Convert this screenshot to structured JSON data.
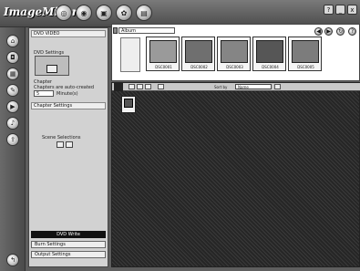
{
  "app": {
    "logo": "ImageMixer"
  },
  "toolbar": {
    "icons": [
      "disc-icon",
      "globe-icon",
      "print-icon",
      "gear-icon",
      "film-icon"
    ]
  },
  "window_controls": {
    "help": "?",
    "minimize": "_",
    "close": "x"
  },
  "left_panel": {
    "section1_title": "DVD VIDEO",
    "button_label": "DVD Settings",
    "option_label": "Chapter",
    "field_label": "Chapters are auto-created",
    "field_value": "5",
    "field_unit": "Minute(s)",
    "section2_title": "Chapter Settings",
    "toggle_label": "Scene Selections",
    "burn_label": "DVD Write",
    "bottom_field_1": "Burn Settings",
    "bottom_field_2": "Output Settings"
  },
  "browser": {
    "folder_name": "Album",
    "thumbnails": [
      {
        "caption": "DSC0001",
        "color": "#9a9a9a"
      },
      {
        "caption": "DSC0002",
        "color": "#6f6f6f"
      },
      {
        "caption": "DSC0003",
        "color": "#858585"
      },
      {
        "caption": "DSC0004",
        "color": "#565656"
      },
      {
        "caption": "DSC0005",
        "color": "#7c7c7c"
      }
    ]
  },
  "project": {
    "view_label": "Sort by",
    "view_value": "Name"
  }
}
